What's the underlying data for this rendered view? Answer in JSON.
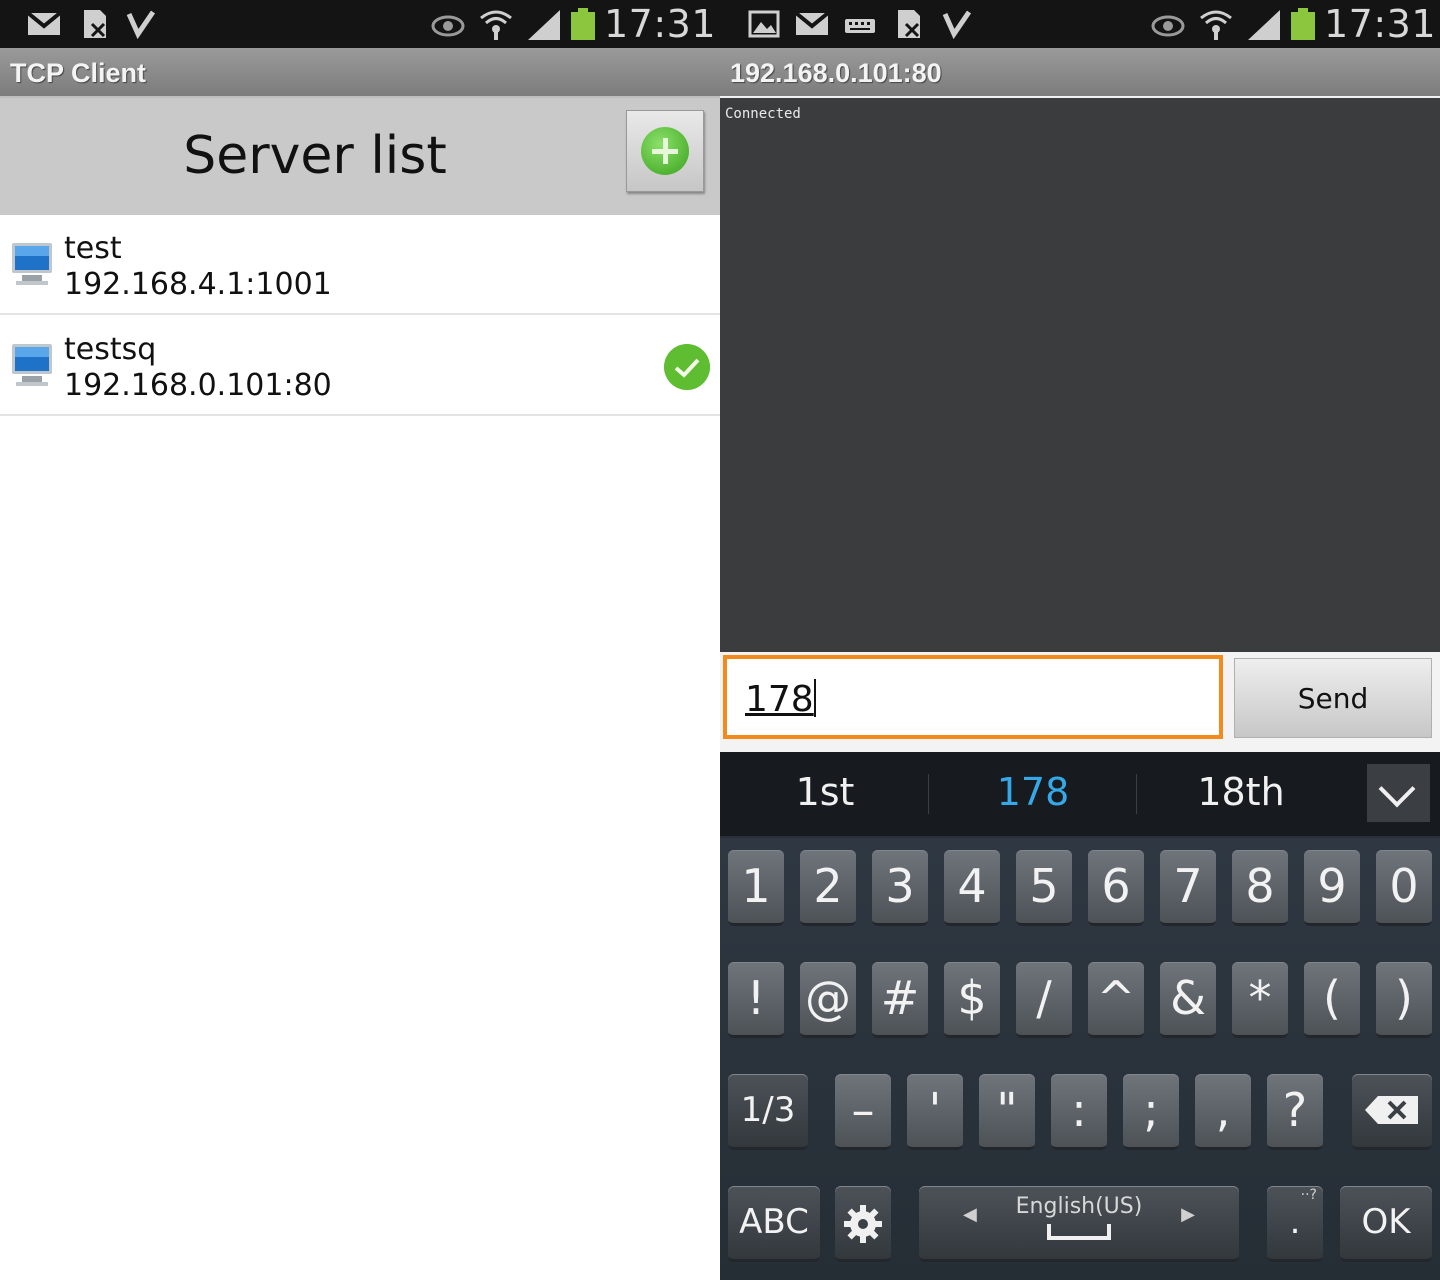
{
  "left": {
    "status_time": "17:31",
    "title": "TCP Client",
    "header": "Server list",
    "servers": [
      {
        "name": "test",
        "address": "192.168.4.1:1001",
        "connected": false
      },
      {
        "name": "testsq",
        "address": "192.168.0.101:80",
        "connected": true
      }
    ]
  },
  "right": {
    "status_time": "17:31",
    "title": "192.168.0.101:80",
    "log_text": "Connected",
    "input_value": "178",
    "send_label": "Send",
    "suggestions": [
      "1st",
      "178",
      "18th"
    ],
    "keyboard": {
      "row1": [
        "1",
        "2",
        "3",
        "4",
        "5",
        "6",
        "7",
        "8",
        "9",
        "0"
      ],
      "row2": [
        "!",
        "@",
        "#",
        "$",
        "/",
        "^",
        "&",
        "*",
        "(",
        ")"
      ],
      "row3": [
        "1/3",
        "–",
        "'",
        "\"",
        ":",
        ";",
        ",",
        "?"
      ],
      "abc_label": "ABC",
      "space_label": "English(US)",
      "ok_label": "OK",
      "period_label": "."
    }
  },
  "colors": {
    "accent_orange": "#f28a1c",
    "suggestion_active": "#35a9e8",
    "check_green": "#46a623"
  }
}
